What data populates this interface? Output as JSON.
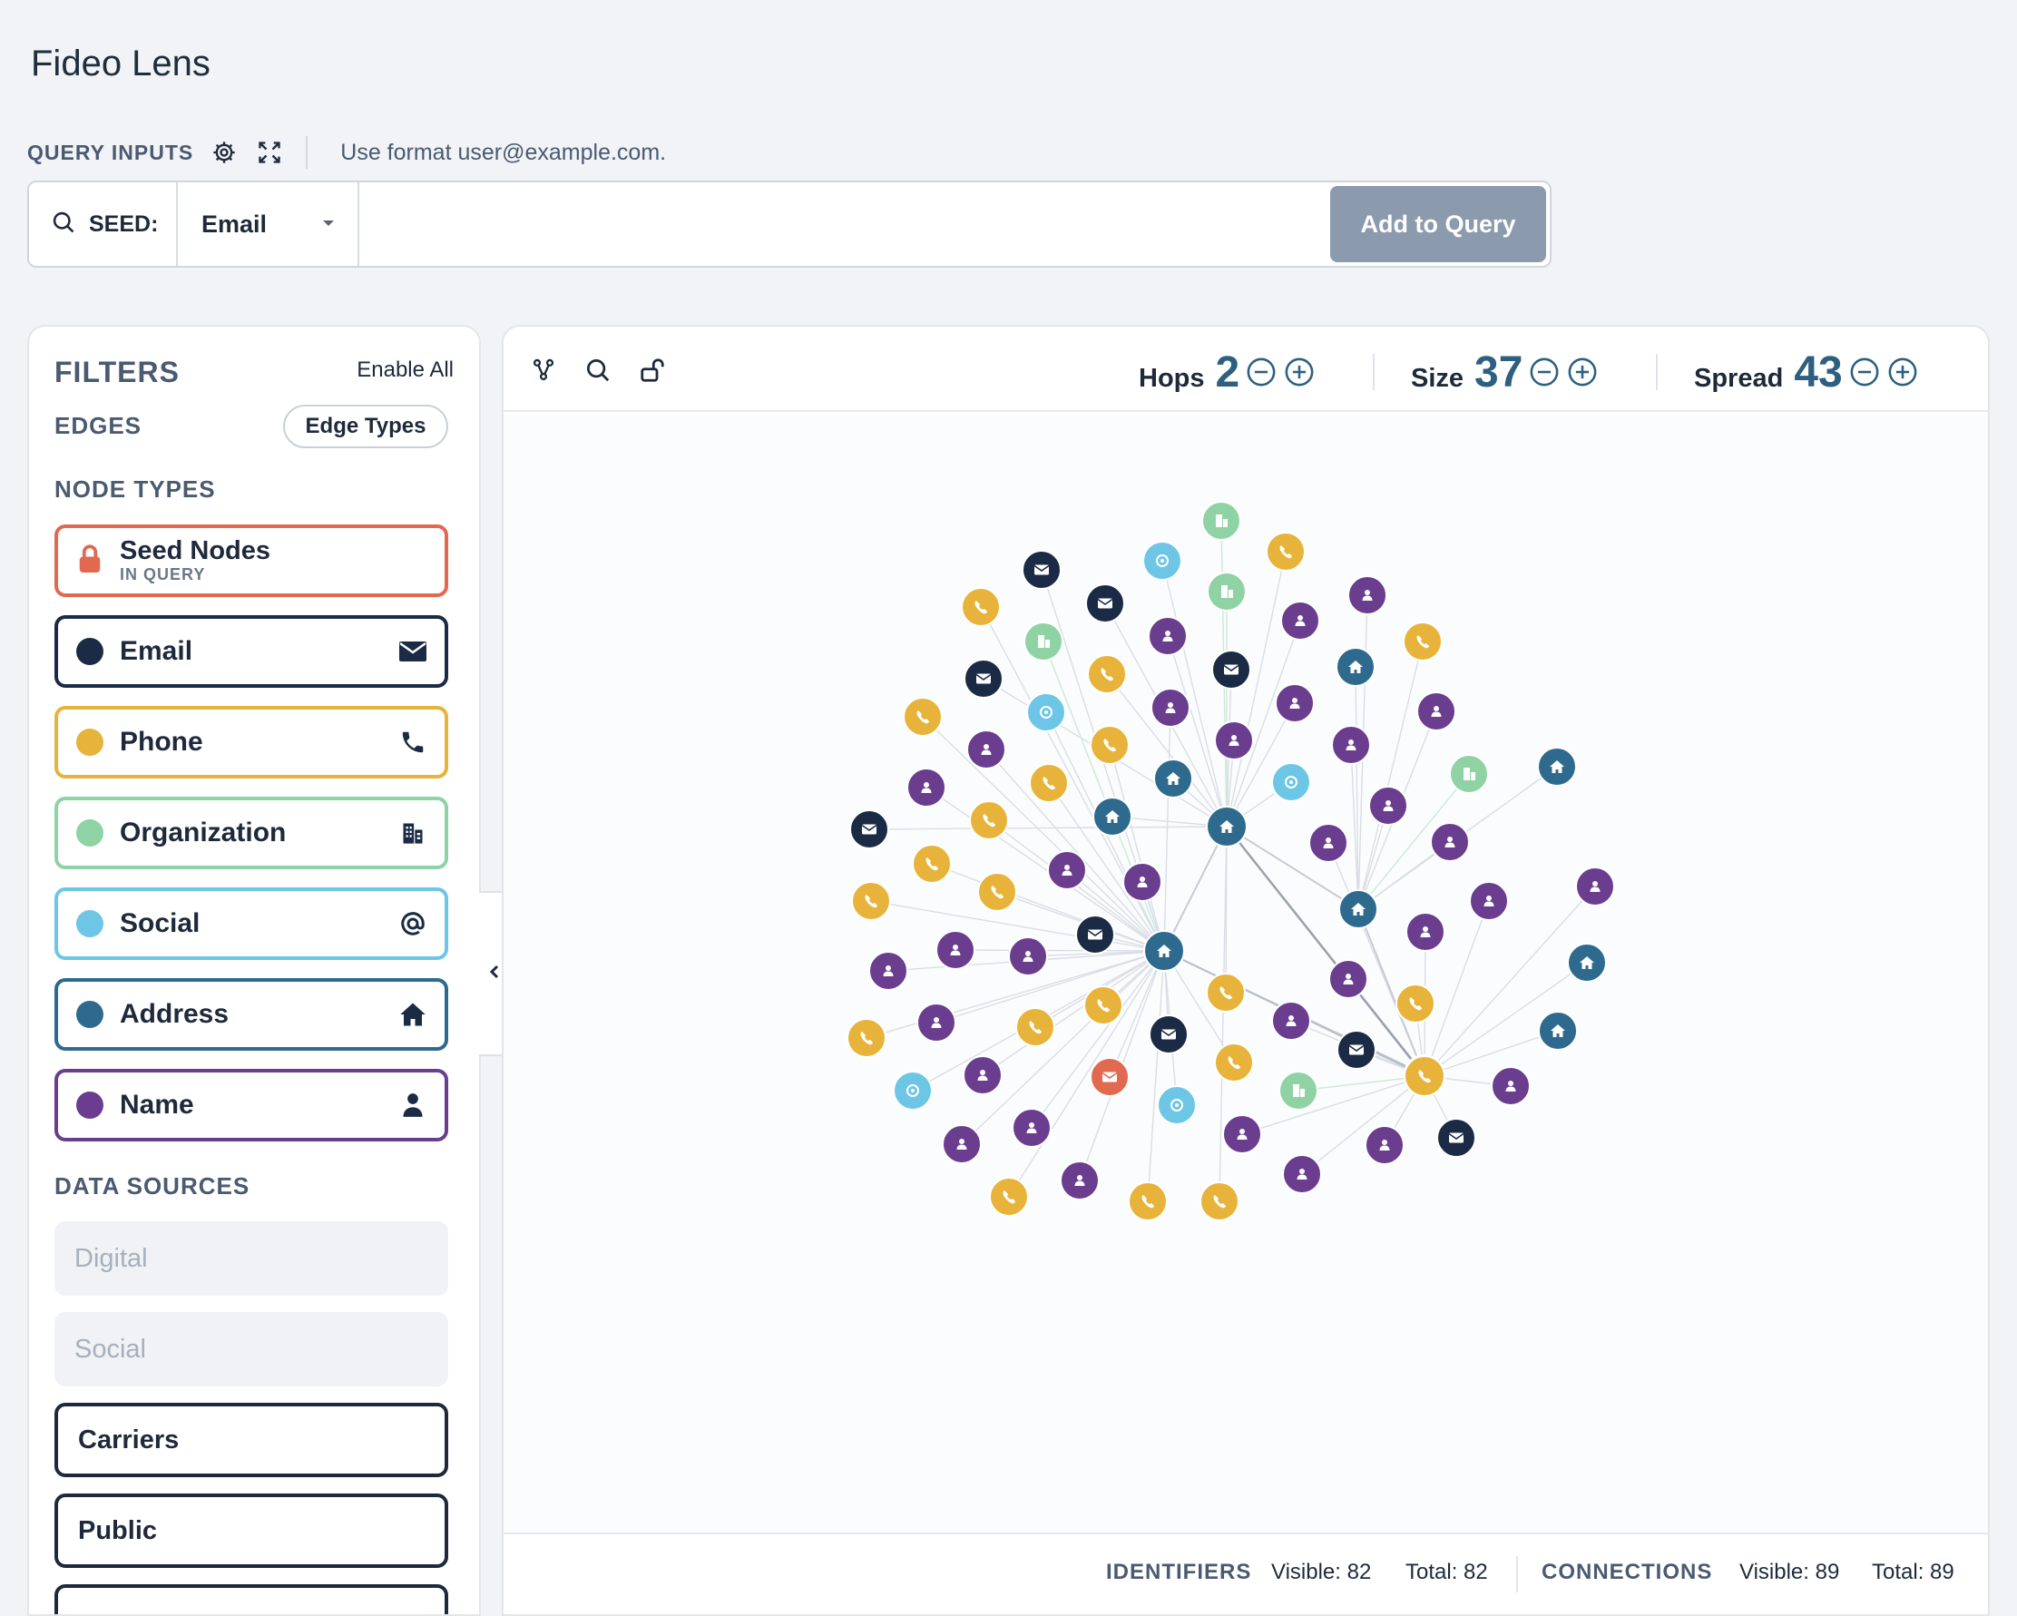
{
  "app": {
    "title": "Fideo Lens"
  },
  "query": {
    "label": "QUERY INPUTS",
    "hint": "Use format user@example.com.",
    "seed_label": "SEED:",
    "seed_type": "Email",
    "seed_value": "",
    "add_button": "Add to Query"
  },
  "filters": {
    "title": "FILTERS",
    "enable_all": "Enable All",
    "edges_title": "EDGES",
    "edge_types_button": "Edge Types",
    "node_types_title": "NODE TYPES",
    "node_types": [
      {
        "label": "Seed Nodes",
        "sublabel": "IN QUERY",
        "color": "#e0694f",
        "icon": "lock-icon"
      },
      {
        "label": "Email",
        "color": "#1b2b45",
        "icon": "envelope-icon"
      },
      {
        "label": "Phone",
        "color": "#e8b33a",
        "icon": "phone-icon"
      },
      {
        "label": "Organization",
        "color": "#8fd3a4",
        "icon": "building-icon"
      },
      {
        "label": "Social",
        "color": "#6ec6e6",
        "icon": "at-icon"
      },
      {
        "label": "Address",
        "color": "#2e6a8e",
        "icon": "home-icon"
      },
      {
        "label": "Name",
        "color": "#6a3d8f",
        "icon": "person-icon"
      }
    ],
    "data_sources_title": "DATA SOURCES",
    "data_sources": [
      {
        "label": "Digital",
        "enabled": false
      },
      {
        "label": "Social",
        "enabled": false
      },
      {
        "label": "Carriers",
        "enabled": true
      },
      {
        "label": "Public",
        "enabled": true
      }
    ]
  },
  "controls": {
    "hops": {
      "label": "Hops",
      "value": "2"
    },
    "size": {
      "label": "Size",
      "value": "37"
    },
    "spread": {
      "label": "Spread",
      "value": "43"
    }
  },
  "stats": {
    "identifiers_label": "IDENTIFIERS",
    "identifiers_visible": "Visible: 82",
    "identifiers_total": "Total: 82",
    "connections_label": "CONNECTIONS",
    "connections_visible": "Visible: 89",
    "connections_total": "Total: 89"
  },
  "colors": {
    "email": "#1b2b45",
    "phone": "#e8b33a",
    "organization": "#8fd3a4",
    "social": "#6ec6e6",
    "address": "#2e6a8e",
    "name": "#6a3d8f",
    "seed": "#e0694f"
  }
}
